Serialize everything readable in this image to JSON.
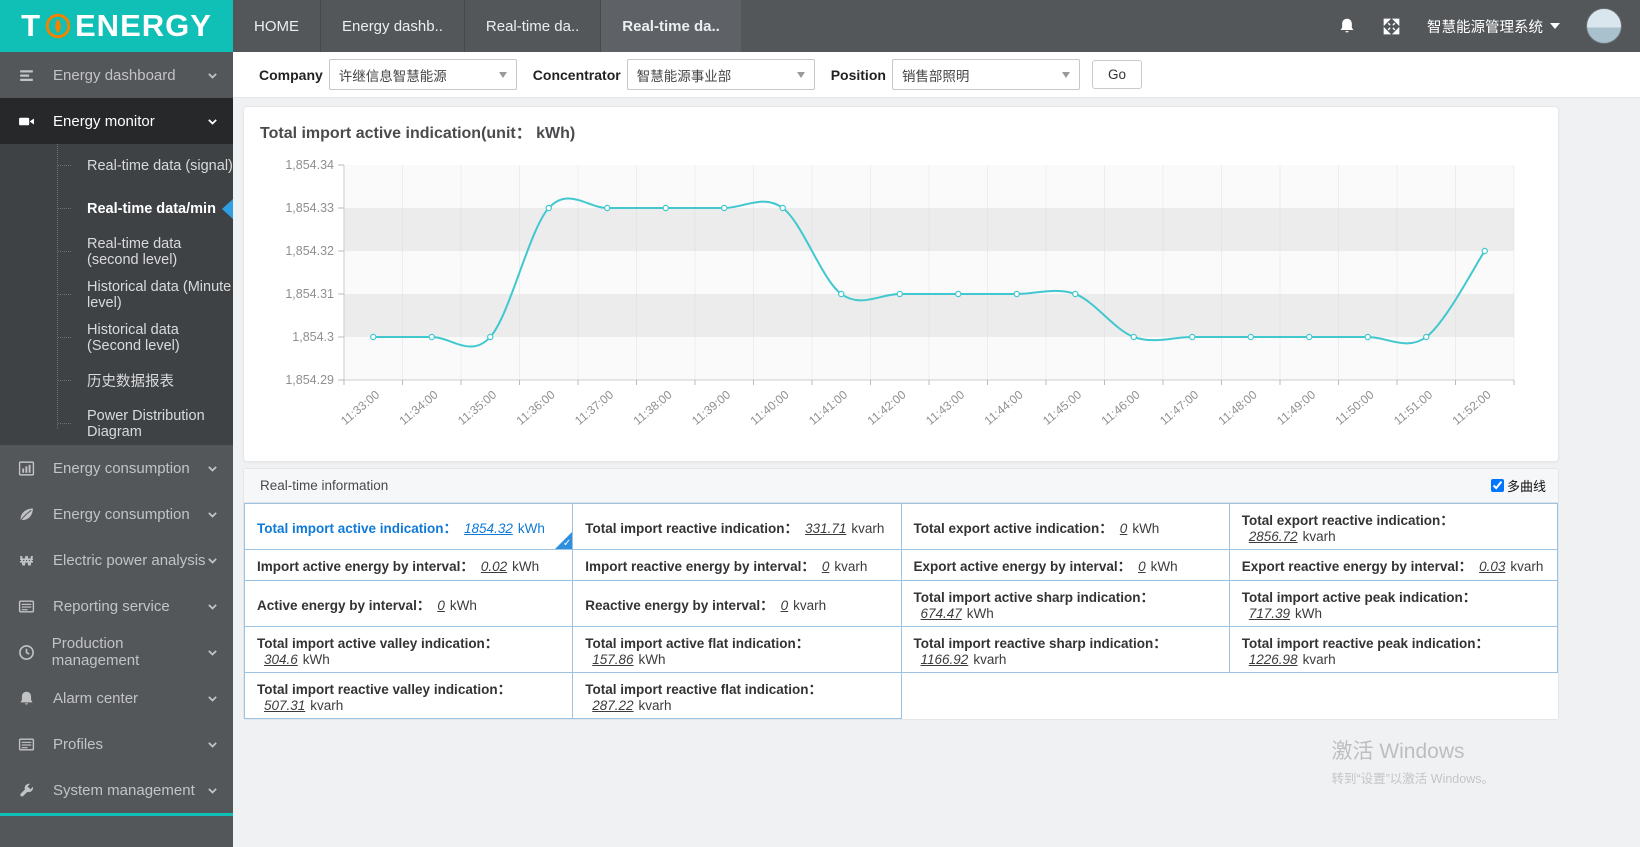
{
  "header": {
    "logo": {
      "text1": "T",
      "text2": "ENERGY"
    },
    "tabs": [
      {
        "id": "home",
        "label": "HOME",
        "active": false
      },
      {
        "id": "energy-dashboard",
        "label": "Energy dashb..",
        "active": false
      },
      {
        "id": "realtime-1",
        "label": "Real-time da..",
        "active": false
      },
      {
        "id": "realtime-2",
        "label": "Real-time da..",
        "active": true
      }
    ],
    "system_name": "智慧能源管理系统"
  },
  "sidebar": {
    "items": [
      {
        "id": "energy-dashboard",
        "label": "Energy dashboard",
        "icon": "dashboard-icon",
        "expanded": false
      },
      {
        "id": "energy-monitor",
        "label": "Energy monitor",
        "icon": "video-icon",
        "expanded": true,
        "children": [
          {
            "id": "realtime-signal",
            "label": "Real-time data (signal)",
            "active": false
          },
          {
            "id": "realtime-min",
            "label": "Real-time data/min",
            "active": true
          },
          {
            "id": "realtime-second",
            "label": "Real-time data (second level)",
            "active": false
          },
          {
            "id": "historical-minute",
            "label": "Historical data (Minute level)",
            "active": false
          },
          {
            "id": "historical-second",
            "label": "Historical data (Second level)",
            "active": false
          },
          {
            "id": "history-report",
            "label": "历史数据报表",
            "active": false
          },
          {
            "id": "power-distribution",
            "label": "Power Distribution Diagram",
            "active": false
          }
        ]
      },
      {
        "id": "energy-consumption-1",
        "label": "Energy consumption",
        "icon": "bar-chart-icon",
        "expanded": false
      },
      {
        "id": "energy-consumption-2",
        "label": "Energy consumption",
        "icon": "leaf-icon",
        "expanded": false
      },
      {
        "id": "electric-power-analysis",
        "label": "Electric power analysis",
        "icon": "won-icon",
        "expanded": false
      },
      {
        "id": "reporting-service",
        "label": "Reporting service",
        "icon": "report-icon",
        "expanded": false
      },
      {
        "id": "production-management",
        "label": "Production management",
        "icon": "clock-icon",
        "expanded": false
      },
      {
        "id": "alarm-center",
        "label": "Alarm center",
        "icon": "bell-icon",
        "expanded": false
      },
      {
        "id": "profiles",
        "label": "Profiles",
        "icon": "list-icon",
        "expanded": false
      },
      {
        "id": "system-management",
        "label": "System management",
        "icon": "wrench-icon",
        "expanded": false
      }
    ]
  },
  "filters": {
    "company_label": "Company",
    "company_value": "许继信息智慧能源",
    "concentrator_label": "Concentrator",
    "concentrator_value": "智慧能源事业部",
    "position_label": "Position",
    "position_value": "销售部照明",
    "go_label": "Go"
  },
  "chart_data": {
    "type": "line",
    "title": "Total import active indication(unit： kWh)",
    "x": [
      "11:33:00",
      "11:34:00",
      "11:35:00",
      "11:36:00",
      "11:37:00",
      "11:38:00",
      "11:39:00",
      "11:40:00",
      "11:41:00",
      "11:42:00",
      "11:43:00",
      "11:44:00",
      "11:45:00",
      "11:46:00",
      "11:47:00",
      "11:48:00",
      "11:49:00",
      "11:50:00",
      "11:51:00",
      "11:52:00"
    ],
    "values": [
      1854.3,
      1854.3,
      1854.3,
      1854.33,
      1854.33,
      1854.33,
      1854.33,
      1854.33,
      1854.31,
      1854.31,
      1854.31,
      1854.31,
      1854.31,
      1854.3,
      1854.3,
      1854.3,
      1854.3,
      1854.3,
      1854.3,
      1854.32
    ],
    "ylim": [
      1854.29,
      1854.34
    ],
    "ytick_labels": [
      "1,854.34",
      "1,854.33",
      "1,854.32",
      "1,854.31",
      "1,854.3",
      "1,854.29"
    ],
    "line_color": "#41c8cf",
    "band_color": "#ececec",
    "grid": true,
    "legend": "none",
    "smooth": true
  },
  "panel": {
    "title": "Real-time information",
    "multi_curve_label": "多曲线",
    "multi_curve_checked": true,
    "check_glyph": "✓",
    "rows": [
      [
        {
          "label": "Total import active indication：",
          "value": "1854.32",
          "unit": "kWh",
          "selected": true
        },
        {
          "label": "Total import reactive indication：",
          "value": "331.71",
          "unit": "kvarh"
        },
        {
          "label": "Total export active indication：",
          "value": "0",
          "unit": "kWh"
        },
        {
          "label": "Total export reactive indication：",
          "value": "2856.72",
          "unit": "kvarh"
        }
      ],
      [
        {
          "label": "Import active energy by interval：",
          "value": "0.02",
          "unit": "kWh"
        },
        {
          "label": "Import reactive energy by interval：",
          "value": "0",
          "unit": "kvarh"
        },
        {
          "label": "Export active energy by interval：",
          "value": "0",
          "unit": "kWh"
        },
        {
          "label": "Export reactive energy by interval：",
          "value": "0.03",
          "unit": "kvarh"
        }
      ],
      [
        {
          "label": "Active energy by interval：",
          "value": "0",
          "unit": "kWh"
        },
        {
          "label": "Reactive energy by interval：",
          "value": "0",
          "unit": "kvarh"
        },
        {
          "label": "Total import active sharp indication：",
          "value": "674.47",
          "unit": "kWh"
        },
        {
          "label": "Total import active peak indication：",
          "value": "717.39",
          "unit": "kWh"
        }
      ],
      [
        {
          "label": "Total import active valley indication：",
          "value": "304.6",
          "unit": "kWh"
        },
        {
          "label": "Total import active flat indication：",
          "value": "157.86",
          "unit": "kWh"
        },
        {
          "label": "Total import reactive sharp indication：",
          "value": "1166.92",
          "unit": "kvarh"
        },
        {
          "label": "Total import reactive peak indication：",
          "value": "1226.98",
          "unit": "kvarh"
        }
      ],
      [
        {
          "label": "Total import reactive valley indication：",
          "value": "507.31",
          "unit": "kvarh"
        },
        {
          "label": "Total import reactive flat indication：",
          "value": "287.22",
          "unit": "kvarh"
        },
        {
          "empty": true
        },
        {
          "empty": true
        }
      ]
    ]
  },
  "watermark": {
    "line1": "激活 Windows",
    "line2": "转到“设置”以激活 Windows。"
  }
}
